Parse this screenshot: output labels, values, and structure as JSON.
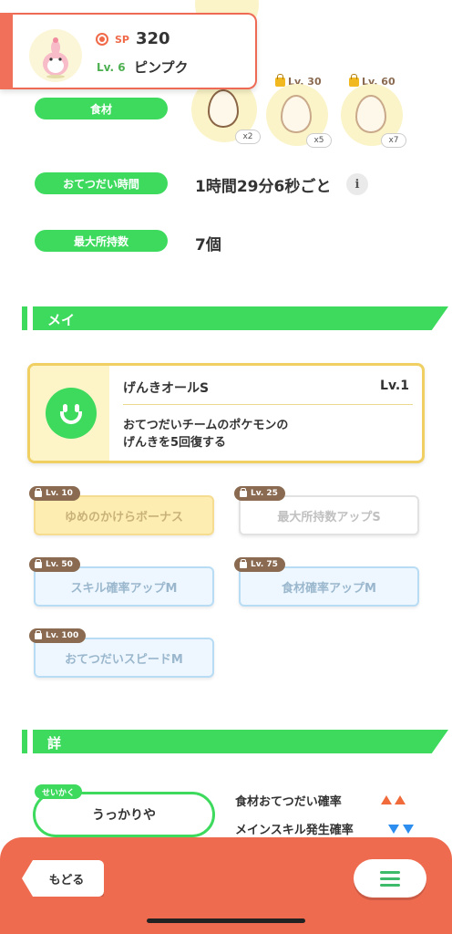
{
  "header": {
    "sp_label": "SP",
    "sp_value": "320",
    "level": "Lv. 6",
    "pokemon_name": "ピンプク"
  },
  "stats": {
    "ingredients_label": "食材",
    "help_time_label": "おてつだい時間",
    "help_time_value": "1時間29分6秒ごと",
    "max_carry_label": "最大所持数",
    "max_carry_value": "7個"
  },
  "ingredients": [
    {
      "count": "x2",
      "unlock": ""
    },
    {
      "count": "x5",
      "unlock": "Lv. 30"
    },
    {
      "count": "x7",
      "unlock": "Lv. 60"
    }
  ],
  "sections": {
    "skills_title": "メインスキル・サブスキル",
    "details_title": "詳細ステータス"
  },
  "main_skill": {
    "name": "げんきオールS",
    "level": "Lv.1",
    "desc_line1": "おてつだいチームのポケモンの",
    "desc_line2": "げんきを5回復する"
  },
  "sub_skills": [
    {
      "unlock": "Lv. 10",
      "name": "ゆめのかけらボーナス"
    },
    {
      "unlock": "Lv. 25",
      "name": "最大所持数アップS"
    },
    {
      "unlock": "Lv. 50",
      "name": "スキル確率アップM"
    },
    {
      "unlock": "Lv. 75",
      "name": "食材確率アップM"
    },
    {
      "unlock": "Lv. 100",
      "name": "おてつだいスピードM"
    }
  ],
  "nature": {
    "tag": "せいかく",
    "value": "うっかりや",
    "effect_up": "食材おてつだい確率",
    "effect_down": "メインスキル発生確率"
  },
  "footer": {
    "back_label": "もどる"
  },
  "colors": {
    "green": "#3dda5e",
    "coral": "#ef6b50",
    "up_arrow": "#f06a3a",
    "down_arrow": "#2d8ef0"
  }
}
